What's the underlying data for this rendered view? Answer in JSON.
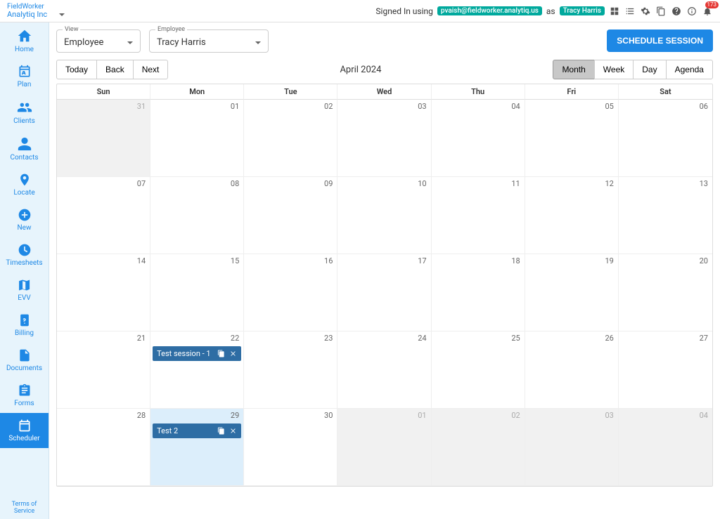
{
  "brand": "FieldWorker",
  "org": "Analytiq Inc",
  "header": {
    "signedInPrefix": "Signed In using",
    "email": "pvaish@fieldworker.analytiq.us",
    "asWord": "as",
    "userName": "Tracy Harris",
    "notifCount": "173"
  },
  "nav": {
    "home": "Home",
    "plan": "Plan",
    "clients": "Clients",
    "contacts": "Contacts",
    "locate": "Locate",
    "new": "New",
    "timesheets": "Timesheets",
    "evv": "EVV",
    "billing": "Billing",
    "documents": "Documents",
    "forms": "Forms",
    "scheduler": "Scheduler",
    "tos": "Terms of Service"
  },
  "controls": {
    "viewLabel": "View",
    "viewValue": "Employee",
    "employeeLabel": "Employee",
    "employeeValue": "Tracy Harris",
    "scheduleBtn": "SCHEDULE SESSION"
  },
  "toolbar": {
    "today": "Today",
    "back": "Back",
    "next": "Next",
    "title": "April 2024",
    "month": "Month",
    "week": "Week",
    "day": "Day",
    "agenda": "Agenda"
  },
  "dayHeaders": {
    "sun": "Sun",
    "mon": "Mon",
    "tue": "Tue",
    "wed": "Wed",
    "thu": "Thu",
    "fri": "Fri",
    "sat": "Sat"
  },
  "cells": {
    "w1": [
      "31",
      "01",
      "02",
      "03",
      "04",
      "05",
      "06"
    ],
    "w2": [
      "07",
      "08",
      "09",
      "10",
      "11",
      "12",
      "13"
    ],
    "w3": [
      "14",
      "15",
      "16",
      "17",
      "18",
      "19",
      "20"
    ],
    "w4": [
      "21",
      "22",
      "23",
      "24",
      "25",
      "26",
      "27"
    ],
    "w5": [
      "28",
      "29",
      "30",
      "01",
      "02",
      "03",
      "04"
    ]
  },
  "events": {
    "e1": "Test session - 1",
    "e2": "Test 2"
  }
}
